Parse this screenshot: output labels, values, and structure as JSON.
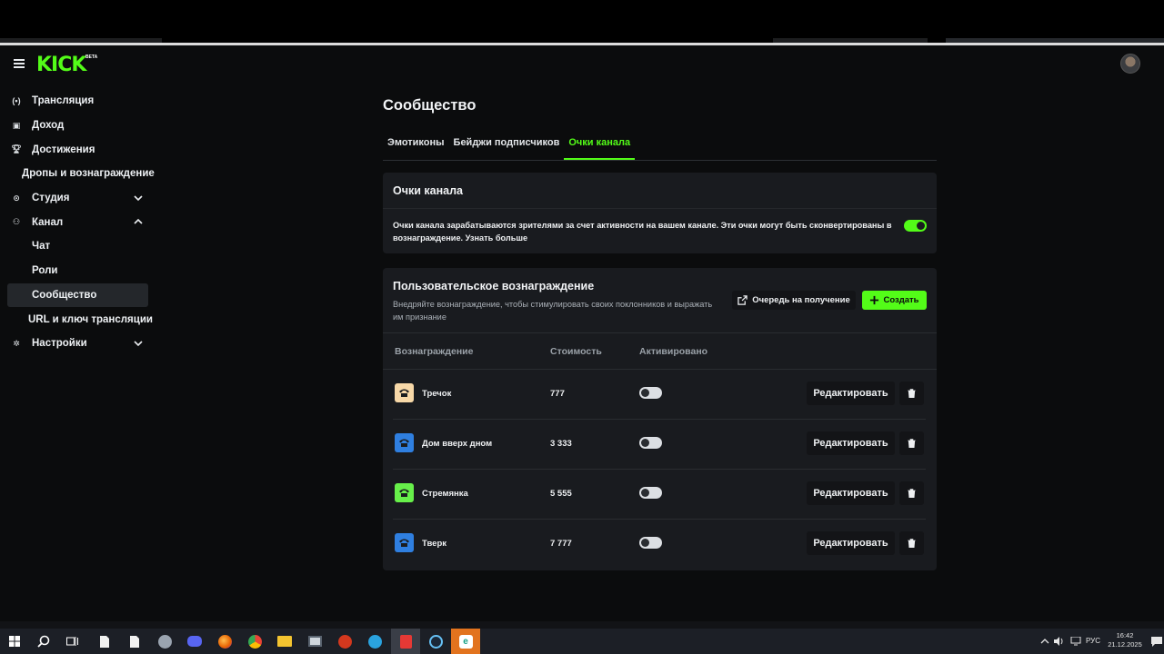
{
  "app": {
    "logo": "KICK",
    "logo_badge": "BETA"
  },
  "sidebar": {
    "items": [
      {
        "label": "Трансляция",
        "icon": "broadcast-icon"
      },
      {
        "label": "Доход",
        "icon": "wallet-icon"
      },
      {
        "label": "Достижения",
        "icon": "trophy-icon"
      },
      {
        "label": "Дропы и вознаграждение"
      },
      {
        "label": "Студия",
        "icon": "studio-icon",
        "expandable": true,
        "expanded": false
      },
      {
        "label": "Канал",
        "icon": "channel-icon",
        "expandable": true,
        "expanded": true
      },
      {
        "label": "Чат"
      },
      {
        "label": "Роли"
      },
      {
        "label": "Сообщество",
        "active": true
      },
      {
        "label": "URL и ключ трансляции"
      },
      {
        "label": "Настройки",
        "icon": "gear-icon",
        "expandable": true,
        "expanded": false
      }
    ]
  },
  "main": {
    "title": "Сообщество",
    "tabs": [
      {
        "label": "Эмотиконы"
      },
      {
        "label": "Бейджи подписчиков"
      },
      {
        "label": "Очки канала",
        "active": true
      }
    ],
    "points_card": {
      "title": "Очки канала",
      "description": "Очки канала зарабатываются зрителями за счет активности на вашем канале. Эти очки могут быть сконвертированы в вознаграждение. Узнать больше",
      "enabled": true
    },
    "rewards_card": {
      "title": "Пользовательское вознаграждение",
      "subtitle": "Внедряйте вознаграждение, чтобы стимулировать своих поклонников и выражать им признание",
      "queue_button": "Очередь на получение",
      "create_button": "Создать",
      "columns": [
        "Вознаграждение",
        "Стоимость",
        "Активировано"
      ],
      "edit_label": "Редактировать",
      "rows": [
        {
          "name": "Тречок",
          "cost": "777",
          "active": false,
          "color": "#f7d8a8"
        },
        {
          "name": "Дом вверх дном",
          "cost": "3 333",
          "active": false,
          "color": "#2f7fe0"
        },
        {
          "name": "Стремянка",
          "cost": "5 555",
          "active": false,
          "color": "#67f04a"
        },
        {
          "name": "Тверк",
          "cost": "7 777",
          "active": false,
          "color": "#2f7fe0"
        }
      ]
    }
  },
  "taskbar": {
    "language": "РУС",
    "time": "16:42",
    "date": "21.12.2025"
  },
  "colors": {
    "accent": "#53fc18",
    "background": "#0b0c0d",
    "card": "#191b1f"
  }
}
